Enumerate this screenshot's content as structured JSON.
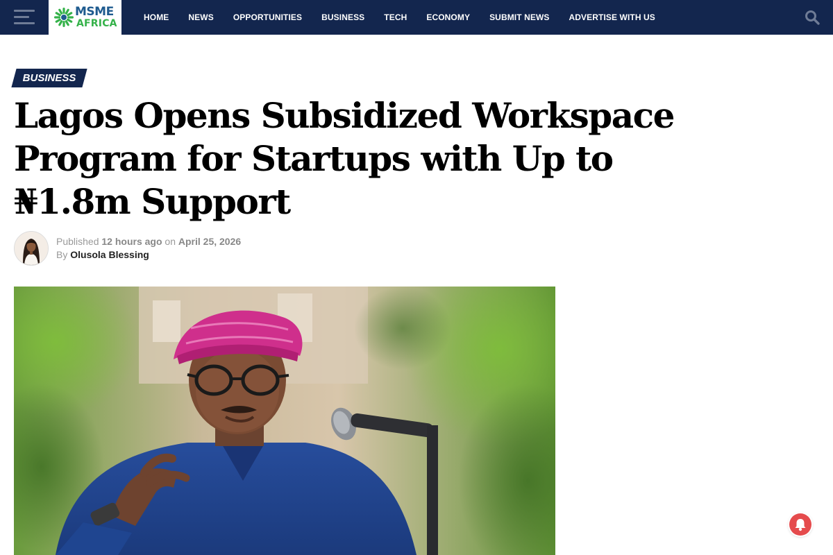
{
  "site": {
    "logo_text_top": "MSME",
    "logo_text_bottom": "AFRICA",
    "brand_navy": "#13264e",
    "brand_green": "#35b24a",
    "brand_blue": "#1f5b8f"
  },
  "nav": {
    "menu_icon": "hamburger-menu-icon",
    "search_icon": "search-icon",
    "items": [
      {
        "label": "HOME"
      },
      {
        "label": "NEWS"
      },
      {
        "label": "OPPORTUNITIES"
      },
      {
        "label": "BUSINESS"
      },
      {
        "label": "TECH"
      },
      {
        "label": "ECONOMY"
      },
      {
        "label": "SUBMIT NEWS"
      },
      {
        "label": "ADVERTISE WITH US"
      }
    ]
  },
  "article": {
    "category": "BUSINESS",
    "title": "Lagos Opens Subsidized Workspace Program for Startups with Up to ₦1.8m Support",
    "published_label": "Published",
    "relative_time": "12 hours ago",
    "on_label": "on",
    "date": "April 25, 2026",
    "by_label": "By",
    "author": "Olusola Blessing"
  },
  "notification": {
    "icon": "bell-icon",
    "accent_color": "#e54b4d"
  }
}
